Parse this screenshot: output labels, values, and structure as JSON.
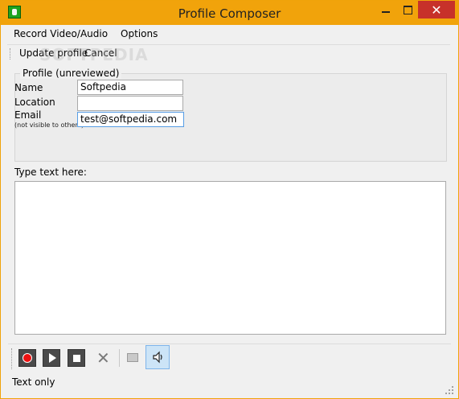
{
  "window": {
    "title": "Profile Composer"
  },
  "menu": {
    "items": [
      "Record Video/Audio",
      "Options"
    ]
  },
  "toolbar": {
    "update_label": "Update profile",
    "cancel_label": "Cancel"
  },
  "watermark": "SOFTPEDIA",
  "profile": {
    "group_label": "Profile (unreviewed)",
    "name_label": "Name",
    "name_value": "Softpedia",
    "location_label": "Location",
    "location_value": "",
    "email_label": "Email",
    "email_note": "(not visible to others)",
    "email_value": "test@softpedia.com"
  },
  "message": {
    "label": "Type text here:",
    "value": ""
  },
  "media": {
    "buttons": [
      "record-icon",
      "play-icon",
      "stop-icon",
      "delete-icon",
      "screen-icon",
      "speaker-icon"
    ]
  },
  "status": {
    "text": "Text only"
  },
  "colors": {
    "titlebar": "#f1a30b",
    "close": "#c7312a",
    "record": "#e11111"
  }
}
